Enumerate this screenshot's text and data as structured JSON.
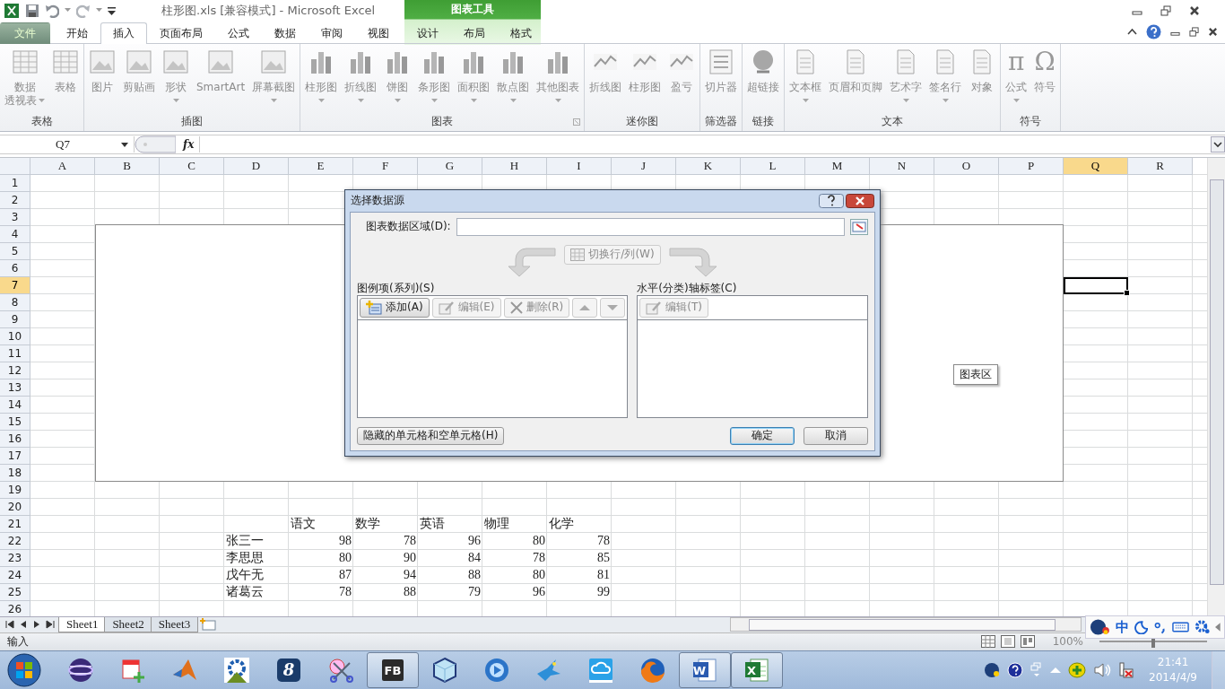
{
  "window": {
    "title": "柱形图.xls  [兼容模式]  -  Microsoft Excel"
  },
  "context_tab_group": {
    "label": "图表工具"
  },
  "tabs": [
    {
      "label": "文件",
      "kind": "file",
      "selected": false
    },
    {
      "label": "开始",
      "kind": "normal",
      "selected": false
    },
    {
      "label": "插入",
      "kind": "normal",
      "selected": true
    },
    {
      "label": "页面布局",
      "kind": "normal",
      "selected": false
    },
    {
      "label": "公式",
      "kind": "normal",
      "selected": false
    },
    {
      "label": "数据",
      "kind": "normal",
      "selected": false
    },
    {
      "label": "审阅",
      "kind": "normal",
      "selected": false
    },
    {
      "label": "视图",
      "kind": "normal",
      "selected": false
    },
    {
      "label": "设计",
      "kind": "context",
      "selected": false
    },
    {
      "label": "布局",
      "kind": "context",
      "selected": false
    },
    {
      "label": "格式",
      "kind": "context",
      "selected": false
    }
  ],
  "ribbon_groups": [
    {
      "label": "表格",
      "launcher": false,
      "buttons": [
        {
          "lines": [
            "数据",
            "透视表"
          ],
          "dropdown": true,
          "disabled": true
        },
        {
          "lines": [
            "表格"
          ],
          "dropdown": false,
          "disabled": true
        }
      ]
    },
    {
      "label": "插图",
      "launcher": false,
      "buttons": [
        {
          "lines": [
            "图片"
          ],
          "dropdown": false,
          "disabled": true
        },
        {
          "lines": [
            "剪贴画"
          ],
          "dropdown": false,
          "disabled": true
        },
        {
          "lines": [
            "形状"
          ],
          "dropdown": true,
          "disabled": true
        },
        {
          "lines": [
            "SmartArt"
          ],
          "dropdown": false,
          "disabled": true
        },
        {
          "lines": [
            "屏幕截图"
          ],
          "dropdown": true,
          "disabled": true
        }
      ]
    },
    {
      "label": "图表",
      "launcher": true,
      "buttons": [
        {
          "lines": [
            "柱形图"
          ],
          "dropdown": true,
          "disabled": true
        },
        {
          "lines": [
            "折线图"
          ],
          "dropdown": true,
          "disabled": true
        },
        {
          "lines": [
            "饼图"
          ],
          "dropdown": true,
          "disabled": true
        },
        {
          "lines": [
            "条形图"
          ],
          "dropdown": true,
          "disabled": true
        },
        {
          "lines": [
            "面积图"
          ],
          "dropdown": true,
          "disabled": true
        },
        {
          "lines": [
            "散点图"
          ],
          "dropdown": true,
          "disabled": true
        },
        {
          "lines": [
            "其他图表"
          ],
          "dropdown": true,
          "disabled": true
        }
      ]
    },
    {
      "label": "迷你图",
      "launcher": false,
      "buttons": [
        {
          "lines": [
            "折线图"
          ],
          "dropdown": false,
          "disabled": true
        },
        {
          "lines": [
            "柱形图"
          ],
          "dropdown": false,
          "disabled": true
        },
        {
          "lines": [
            "盈亏"
          ],
          "dropdown": false,
          "disabled": true
        }
      ]
    },
    {
      "label": "筛选器",
      "launcher": false,
      "buttons": [
        {
          "lines": [
            "切片器"
          ],
          "dropdown": false,
          "disabled": true
        }
      ]
    },
    {
      "label": "链接",
      "launcher": false,
      "buttons": [
        {
          "lines": [
            "超链接"
          ],
          "dropdown": false,
          "disabled": true
        }
      ]
    },
    {
      "label": "文本",
      "launcher": false,
      "buttons": [
        {
          "lines": [
            "文本框"
          ],
          "dropdown": true,
          "disabled": true
        },
        {
          "lines": [
            "页眉和页脚"
          ],
          "dropdown": false,
          "disabled": true
        },
        {
          "lines": [
            "艺术字"
          ],
          "dropdown": true,
          "disabled": true
        },
        {
          "lines": [
            "签名行"
          ],
          "dropdown": true,
          "disabled": true
        },
        {
          "lines": [
            "对象"
          ],
          "dropdown": false,
          "disabled": true
        }
      ]
    },
    {
      "label": "符号",
      "launcher": false,
      "buttons": [
        {
          "glyph": "π",
          "lines": [
            "公式"
          ],
          "dropdown": true,
          "disabled": true
        },
        {
          "glyph": "Ω",
          "lines": [
            "符号"
          ],
          "dropdown": false,
          "disabled": true
        }
      ]
    }
  ],
  "formula_bar": {
    "name_box": "Q7",
    "fx": "fx"
  },
  "columns": [
    {
      "label": "A",
      "selected": false
    },
    {
      "label": "B",
      "selected": false
    },
    {
      "label": "C",
      "selected": false
    },
    {
      "label": "D",
      "selected": false
    },
    {
      "label": "E",
      "selected": false
    },
    {
      "label": "F",
      "selected": false
    },
    {
      "label": "G",
      "selected": false
    },
    {
      "label": "H",
      "selected": false
    },
    {
      "label": "I",
      "selected": false
    },
    {
      "label": "J",
      "selected": false
    },
    {
      "label": "K",
      "selected": false
    },
    {
      "label": "L",
      "selected": false
    },
    {
      "label": "M",
      "selected": false
    },
    {
      "label": "N",
      "selected": false
    },
    {
      "label": "O",
      "selected": false
    },
    {
      "label": "P",
      "selected": false
    },
    {
      "label": "Q",
      "selected": true
    },
    {
      "label": "R",
      "selected": false
    }
  ],
  "rows": [
    {
      "number": "1",
      "selected": false
    },
    {
      "number": "2",
      "selected": false
    },
    {
      "number": "3",
      "selected": false
    },
    {
      "number": "4",
      "selected": false
    },
    {
      "number": "5",
      "selected": false
    },
    {
      "number": "6",
      "selected": false
    },
    {
      "number": "7",
      "selected": true
    },
    {
      "number": "8",
      "selected": false
    },
    {
      "number": "9",
      "selected": false
    },
    {
      "number": "10",
      "selected": false
    },
    {
      "number": "11",
      "selected": false
    },
    {
      "number": "12",
      "selected": false
    },
    {
      "number": "13",
      "selected": false
    },
    {
      "number": "14",
      "selected": false
    },
    {
      "number": "15",
      "selected": false
    },
    {
      "number": "16",
      "selected": false
    },
    {
      "number": "17",
      "selected": false
    },
    {
      "number": "18",
      "selected": false
    },
    {
      "number": "19",
      "selected": false
    },
    {
      "number": "20",
      "selected": false
    },
    {
      "number": "21",
      "selected": false
    },
    {
      "number": "22",
      "selected": false
    },
    {
      "number": "23",
      "selected": false
    },
    {
      "number": "24",
      "selected": false
    },
    {
      "number": "25",
      "selected": false
    },
    {
      "number": "26",
      "selected": false
    }
  ],
  "data_table": {
    "headers": [
      "语文",
      "数学",
      "英语",
      "物理",
      "化学"
    ],
    "rows": [
      {
        "name": "张三一",
        "values": [
          "98",
          "78",
          "96",
          "80",
          "78"
        ]
      },
      {
        "name": "李思思",
        "values": [
          "80",
          "90",
          "84",
          "78",
          "85"
        ]
      },
      {
        "name": "戊午无",
        "values": [
          "87",
          "94",
          "88",
          "80",
          "81"
        ]
      },
      {
        "name": "诸葛云",
        "values": [
          "78",
          "88",
          "79",
          "96",
          "99"
        ]
      }
    ]
  },
  "chart_area": {
    "tooltip": "图表区"
  },
  "dialog": {
    "title": "选择数据源",
    "range_label": "图表数据区域(D):",
    "switch_button": {
      "label": "切换行/列(W)",
      "disabled": true
    },
    "series_panel": {
      "label": "图例项(系列)(S)",
      "buttons": [
        {
          "kind": "add",
          "label": "添加(A)",
          "disabled": false
        },
        {
          "kind": "edit",
          "label": "编辑(E)",
          "disabled": true
        },
        {
          "kind": "delete",
          "label": "删除(R)",
          "disabled": true
        },
        {
          "kind": "up",
          "disabled": true
        },
        {
          "kind": "down",
          "disabled": true
        }
      ]
    },
    "axis_panel": {
      "label": "水平(分类)轴标签(C)",
      "buttons": [
        {
          "kind": "edit",
          "label": "编辑(T)",
          "disabled": true
        }
      ]
    },
    "hidden_cells_button": "隐藏的单元格和空单元格(H)",
    "ok_button": "确定",
    "cancel_button": "取消"
  },
  "sheet_tabs": [
    {
      "label": "Sheet1",
      "selected": true
    },
    {
      "label": "Sheet2",
      "selected": false
    },
    {
      "label": "Sheet3",
      "selected": false
    }
  ],
  "status_bar": {
    "mode": "输入",
    "zoom": {
      "reading": "100%",
      "level": 0.5
    }
  },
  "ime_bar": {
    "mode": "中"
  },
  "taskbar": {
    "apps": [
      {
        "running": false
      },
      {
        "running": false
      },
      {
        "running": false
      },
      {
        "running": false
      },
      {
        "running": false,
        "label": "8"
      },
      {
        "running": false
      },
      {
        "running": true,
        "label": "FB"
      },
      {
        "running": false
      },
      {
        "running": false
      },
      {
        "running": false
      },
      {
        "running": false
      },
      {
        "running": false
      },
      {
        "running": true,
        "label": "W"
      },
      {
        "running": true,
        "label": "X"
      }
    ],
    "time": "21:41",
    "date": "2014/4/9"
  }
}
